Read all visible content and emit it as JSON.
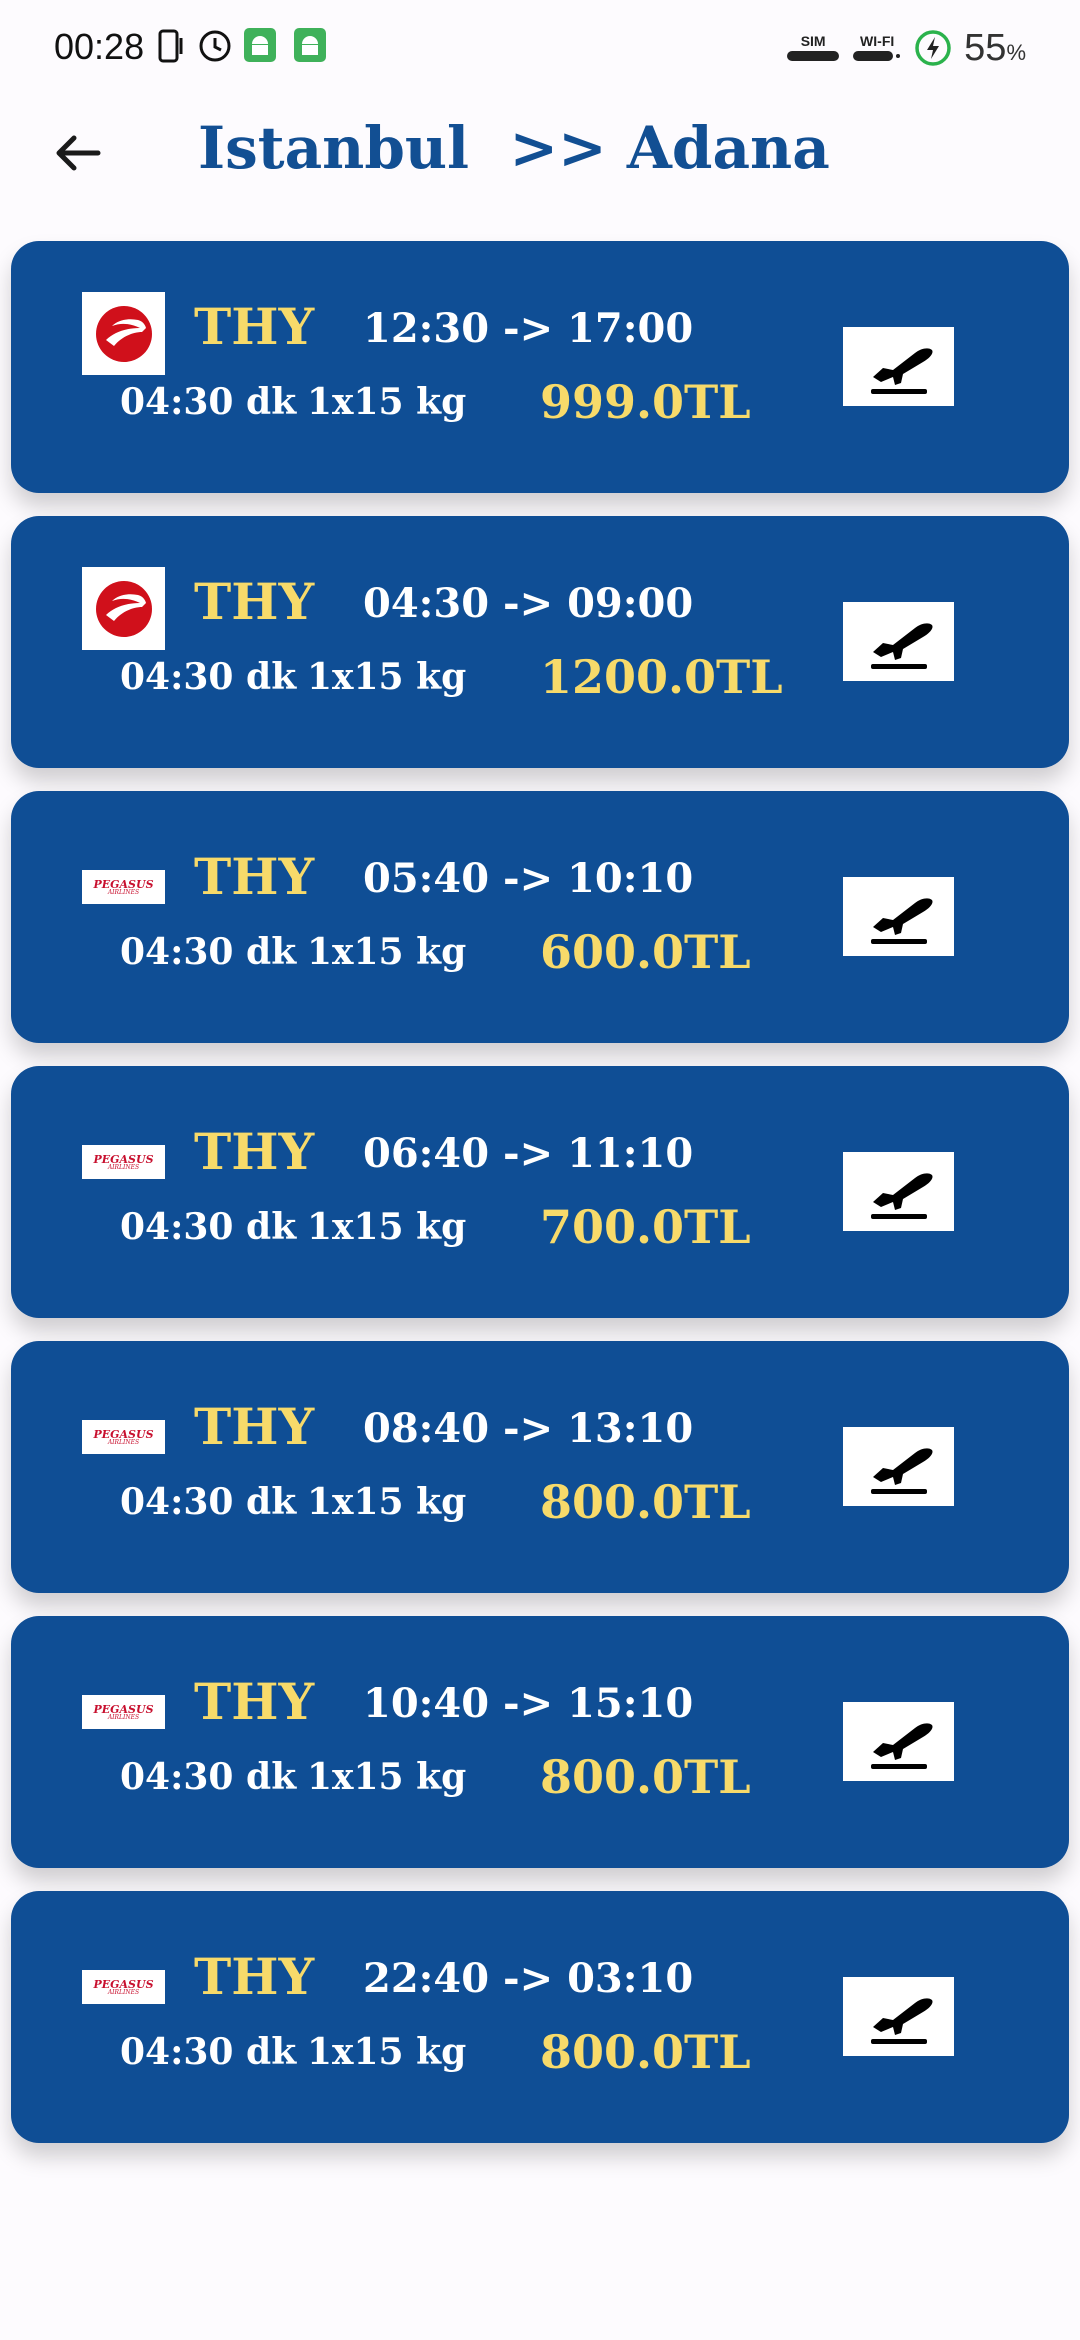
{
  "status_bar": {
    "time": "00:28",
    "battery_percent": "55",
    "battery_unit": "%",
    "sim_label": "SIM",
    "wifi_label": "WI-FI",
    "icons": [
      "vibrate-icon",
      "alarm-icon",
      "android-icon",
      "android-icon",
      "sim-signal-icon",
      "wifi-signal-icon",
      "battery-charging-icon"
    ]
  },
  "header": {
    "origin": "Istanbul",
    "separator": ">>",
    "destination": "Adana",
    "back_icon": "arrow-back-icon"
  },
  "colors": {
    "card_bg": "#0f4e95",
    "accent_yellow": "#f7da6a",
    "title_blue": "#124f93",
    "page_bg": "#fdfbfe"
  },
  "flights": [
    {
      "logo": "thy",
      "airline": "THY",
      "departure": "12:30",
      "arrow": "->",
      "arrival": "17:00",
      "duration": "04:30 dk",
      "baggage": "1x15 kg",
      "price": "999.0TL"
    },
    {
      "logo": "thy",
      "airline": "THY",
      "departure": "04:30",
      "arrow": "->",
      "arrival": "09:00",
      "duration": "04:30 dk",
      "baggage": "1x15 kg",
      "price": "1200.0TL"
    },
    {
      "logo": "pegasus",
      "airline": "THY",
      "departure": "05:40",
      "arrow": "->",
      "arrival": "10:10",
      "duration": "04:30 dk",
      "baggage": "1x15 kg",
      "price": "600.0TL"
    },
    {
      "logo": "pegasus",
      "airline": "THY",
      "departure": "06:40",
      "arrow": "->",
      "arrival": "11:10",
      "duration": "04:30 dk",
      "baggage": "1x15 kg",
      "price": "700.0TL"
    },
    {
      "logo": "pegasus",
      "airline": "THY",
      "departure": "08:40",
      "arrow": "->",
      "arrival": "13:10",
      "duration": "04:30 dk",
      "baggage": "1x15 kg",
      "price": "800.0TL"
    },
    {
      "logo": "pegasus",
      "airline": "THY",
      "departure": "10:40",
      "arrow": "->",
      "arrival": "15:10",
      "duration": "04:30 dk",
      "baggage": "1x15 kg",
      "price": "800.0TL"
    },
    {
      "logo": "pegasus",
      "airline": "THY",
      "departure": "22:40",
      "arrow": "->",
      "arrival": "03:10",
      "duration": "04:30 dk",
      "baggage": "1x15 kg",
      "price": "800.0TL"
    }
  ],
  "logos": {
    "pegasus_text": "PEGASUS",
    "pegasus_sub": "AIRLINES"
  }
}
